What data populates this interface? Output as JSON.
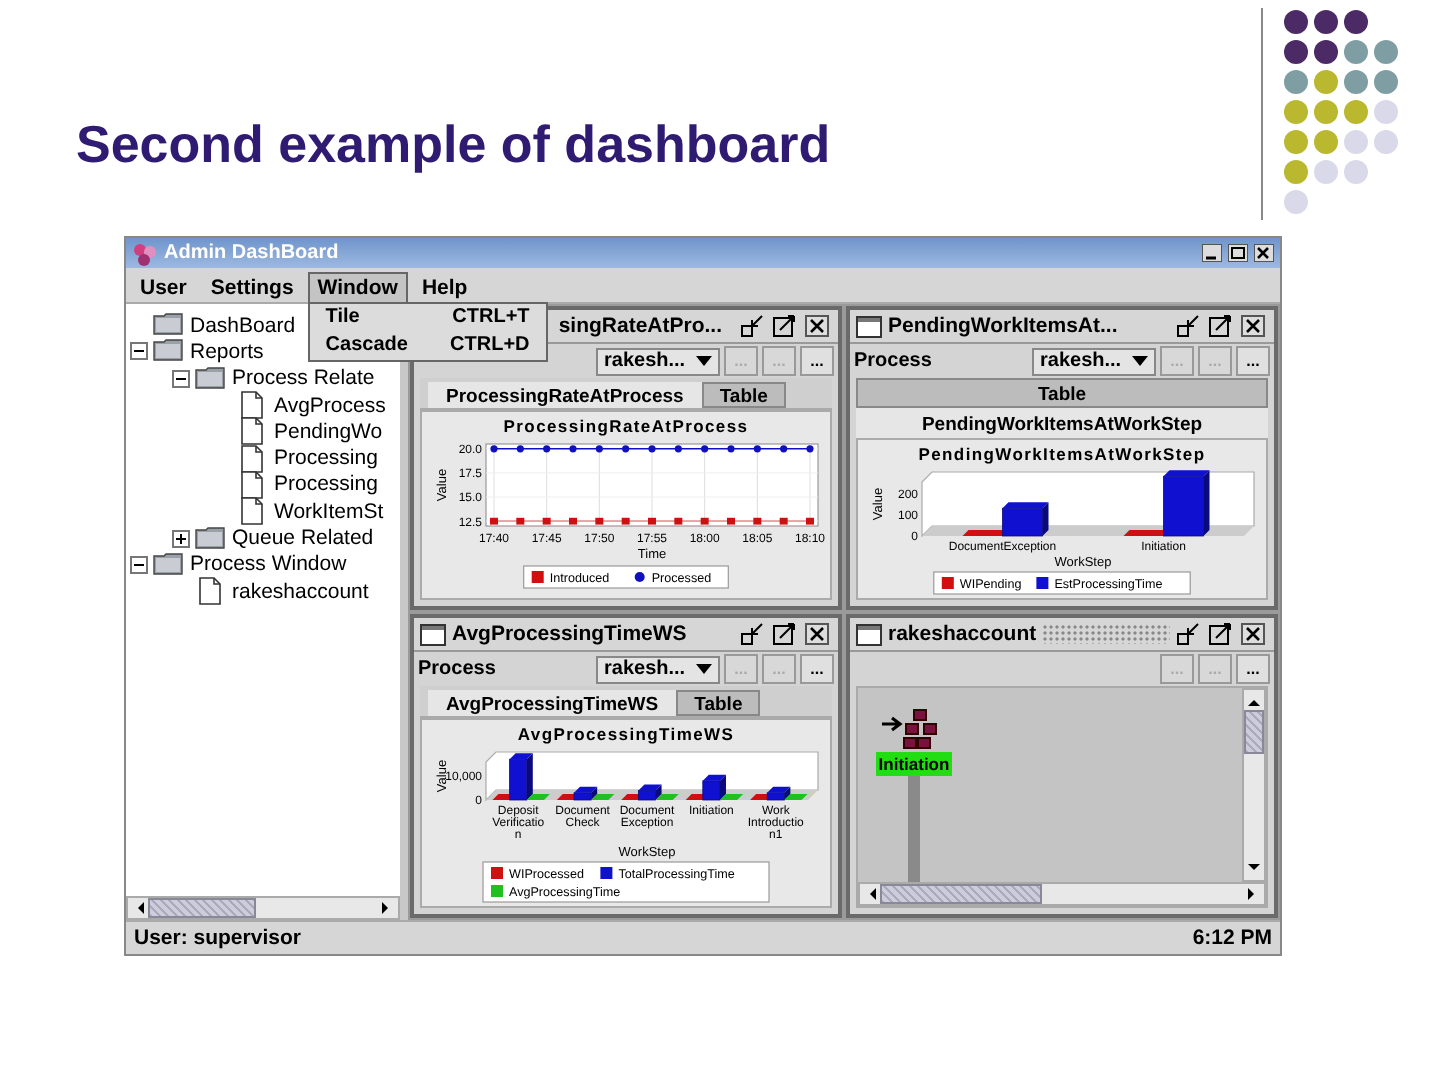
{
  "slide": {
    "title": "Second example of dashboard"
  },
  "window": {
    "title": "Admin DashBoard"
  },
  "menu": [
    {
      "label": "User",
      "open": false
    },
    {
      "label": "Settings",
      "open": false
    },
    {
      "label": "Window",
      "open": true,
      "items": [
        {
          "label": "Tile",
          "shortcut": "CTRL+T"
        },
        {
          "label": "Cascade",
          "shortcut": "CTRL+D"
        }
      ]
    },
    {
      "label": "Help",
      "open": false
    }
  ],
  "tree": [
    {
      "label": "DashBoard",
      "kind": "folder"
    },
    {
      "label": "Reports",
      "kind": "folder",
      "expanded": true,
      "children": [
        {
          "label": "Process Relate",
          "kind": "folder",
          "expanded": true,
          "children": [
            {
              "label": "AvgProcess",
              "kind": "document"
            },
            {
              "label": "PendingWo",
              "kind": "document"
            },
            {
              "label": "Processing",
              "kind": "document"
            },
            {
              "label": "Processing",
              "kind": "document"
            },
            {
              "label": "WorkItemSt",
              "kind": "document"
            }
          ]
        },
        {
          "label": "Queue Related",
          "kind": "folder",
          "expanded": false
        }
      ]
    },
    {
      "label": "Process Window",
      "kind": "folder",
      "expanded": true,
      "children": [
        {
          "label": "rakeshaccount",
          "kind": "document"
        }
      ]
    }
  ],
  "frames": [
    {
      "title": "singRateAtPro...",
      "icon": false,
      "active": false,
      "kind": "chart",
      "process": "rakesh...",
      "buttons": [
        {
          "label": "...",
          "disabled": true
        },
        {
          "label": "...",
          "disabled": true
        },
        {
          "label": "...",
          "disabled": false
        }
      ],
      "tabs_stacked": false,
      "tabs": [
        {
          "label": "ProcessingRateAtProcess",
          "selected": true
        },
        {
          "label": "Table",
          "selected": false
        }
      ],
      "chart_data": {
        "type": "line",
        "title": "ProcessingRateAtProcess",
        "xlabel": "Time",
        "ylabel": "Value",
        "legend": true,
        "grid": true,
        "categories": [
          "17:40",
          null,
          "17:45",
          null,
          "17:50",
          null,
          "17:55",
          null,
          "18:00",
          null,
          "18:05",
          null,
          "18:10"
        ],
        "ylim": [
          12,
          20.5
        ],
        "yticks": [
          12.5,
          {
            "value": 15,
            "label": "15.0"
          },
          17.5,
          {
            "value": 20,
            "label": "20.0"
          }
        ],
        "series": [
          {
            "name": "Introduced",
            "color": "#d01010",
            "marker": "square",
            "values": [
              12.5,
              12.5,
              12.5,
              12.5,
              12.5,
              12.5,
              12.5,
              12.5,
              12.5,
              12.5,
              12.5,
              12.5,
              12.5
            ]
          },
          {
            "name": "Processed",
            "color": "#1010c0",
            "marker": "circle",
            "values": [
              20,
              20,
              20,
              20,
              20,
              20,
              20,
              20,
              20,
              20,
              20,
              20,
              20
            ]
          }
        ]
      }
    },
    {
      "title": "PendingWorkItemsAt...",
      "icon": true,
      "active": false,
      "kind": "chart",
      "process_label": "Process",
      "process": "rakesh...",
      "buttons": [
        {
          "label": "...",
          "disabled": true
        },
        {
          "label": "...",
          "disabled": true
        },
        {
          "label": "...",
          "disabled": false
        }
      ],
      "tabs_stacked": true,
      "tabs": [
        {
          "label": "Table",
          "selected": false
        },
        {
          "label": "PendingWorkItemsAtWorkStep",
          "selected": true
        }
      ],
      "chart_data": {
        "type": "bar",
        "title": "PendingWorkItemsAtWorkStep",
        "xlabel": "WorkStep",
        "ylabel": "Value",
        "legend": true,
        "categories": [
          "DocumentException",
          "Initiation"
        ],
        "ylim": [
          0,
          300
        ],
        "yticks": [
          0,
          100,
          200
        ],
        "series": [
          {
            "name": "WIPending",
            "color": "#d01010",
            "values": [
              0,
              0
            ]
          },
          {
            "name": "EstProcessingTime",
            "color": "#1010d0",
            "values": [
              130,
              280
            ]
          }
        ]
      }
    },
    {
      "title": "AvgProcessingTimeWS",
      "icon": true,
      "active": false,
      "kind": "chart",
      "process_label": "Process",
      "process": "rakesh...",
      "buttons": [
        {
          "label": "...",
          "disabled": true
        },
        {
          "label": "...",
          "disabled": true
        },
        {
          "label": "...",
          "disabled": false
        }
      ],
      "tabs_stacked": false,
      "tabs": [
        {
          "label": "AvgProcessingTimeWS",
          "selected": true
        },
        {
          "label": "Table",
          "selected": false
        }
      ],
      "chart_data": {
        "type": "bar",
        "title": "AvgProcessingTimeWS",
        "xlabel": "WorkStep",
        "ylabel": "Value",
        "legend": true,
        "categories": [
          "Deposit Verificatio n",
          "Document Check",
          "Document Exception",
          "Initiation",
          "Work Introductio n1"
        ],
        "ylim": [
          0,
          20000
        ],
        "yticks": [
          0,
          {
            "value": 10000,
            "label": "10,000"
          }
        ],
        "series": [
          {
            "name": "WIProcessed",
            "color": "#d01010",
            "values": [
              0,
              0,
              0,
              0,
              0
            ]
          },
          {
            "name": "TotalProcessingTime",
            "color": "#1010d0",
            "values": [
              17000,
              3000,
              4000,
              8000,
              3000
            ]
          },
          {
            "name": "AvgProcessingTime",
            "color": "#20c020",
            "values": [
              0,
              0,
              0,
              0,
              0
            ]
          }
        ]
      }
    },
    {
      "title": "rakeshaccount",
      "icon": true,
      "active": true,
      "kind": "graph",
      "buttons": [
        {
          "label": "...",
          "disabled": true
        },
        {
          "label": "...",
          "disabled": true
        },
        {
          "label": "...",
          "disabled": false
        }
      ],
      "node": {
        "label": "Initiation"
      }
    }
  ],
  "status_bar": {
    "user": "User: supervisor",
    "time": "6:12 PM"
  }
}
